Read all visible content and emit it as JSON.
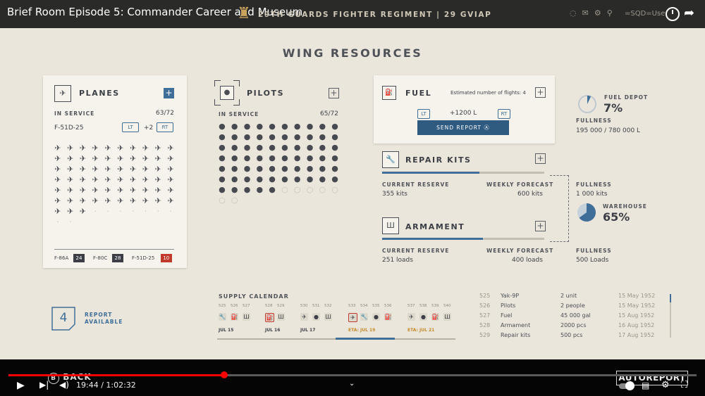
{
  "video": {
    "title": "Brief Room Episode 5: Commander Career and Museum"
  },
  "topbar": {
    "regiment": "29TH GUARDS FIGHTER REGIMENT | 29 GVIAP",
    "user_label": "=SQD=Use"
  },
  "page": {
    "heading": "WING RESOURCES"
  },
  "planes": {
    "title": "PLANES",
    "in_service_label": "IN SERVICE",
    "in_service_count": "63/72",
    "selected": "F-51D-25",
    "lt": "LT",
    "rt": "RT",
    "extra": "+2",
    "icons": [
      "✈",
      "✈",
      "✈",
      "✈",
      "✈",
      "✈",
      "✈",
      "✈",
      "✈",
      "✈",
      "✈",
      "✈",
      "✈",
      "✈",
      "✈",
      "✈",
      "✈",
      "✈",
      "✈",
      "✈",
      "✈",
      "✈",
      "✈",
      "✈",
      "✈",
      "✈",
      "✈",
      "✈",
      "✈",
      "✈",
      "✈",
      "✈",
      "✈",
      "✈",
      "✈",
      "✈",
      "✈",
      "✈",
      "✈",
      "✈",
      "✈",
      "✈",
      "✈",
      "✈",
      "✈",
      "✈",
      "✈",
      "✈",
      "✈",
      "✈",
      "✈",
      "✈",
      "✈",
      "✈",
      "✈",
      "✈",
      "✈",
      "✈",
      "✈",
      "✈",
      "✈",
      "✈",
      "✈",
      "·",
      "·",
      "·",
      "·",
      "·",
      "·",
      "·",
      "·",
      "·"
    ],
    "footer": [
      {
        "name": "F-86A",
        "count": "24"
      },
      {
        "name": "F-80C",
        "count": "28"
      },
      {
        "name": "F-51D-25",
        "count": "10"
      }
    ]
  },
  "pilots": {
    "title": "PILOTS",
    "in_service_label": "IN SERVICE",
    "in_service_count": "65/72",
    "icons": [
      "●",
      "●",
      "●",
      "●",
      "●",
      "●",
      "●",
      "●",
      "●",
      "●",
      "●",
      "●",
      "●",
      "●",
      "●",
      "●",
      "●",
      "●",
      "●",
      "●",
      "●",
      "●",
      "●",
      "●",
      "●",
      "●",
      "●",
      "●",
      "●",
      "●",
      "●",
      "●",
      "●",
      "●",
      "●",
      "●",
      "●",
      "●",
      "●",
      "●",
      "●",
      "●",
      "●",
      "●",
      "●",
      "●",
      "●",
      "●",
      "●",
      "●",
      "●",
      "●",
      "●",
      "●",
      "●",
      "●",
      "●",
      "●",
      "●",
      "●",
      "●",
      "●",
      "●",
      "●",
      "●",
      "○",
      "○",
      "○",
      "○",
      "○",
      "○",
      "○"
    ]
  },
  "fuel": {
    "title": "FUEL",
    "estimate": "Estimated number of flights: 4",
    "lt": "LT",
    "rt": "RT",
    "amount": "+1200 L",
    "send_label": "SEND REPORT",
    "depot_label": "FUEL DEPOT",
    "depot_pct": "7%",
    "depot_fraction": 0.07,
    "fullness_label": "FULLNESS",
    "fullness_value": "195 000 / 780 000 L"
  },
  "repair": {
    "title": "REPAIR KITS",
    "reserve_label": "CURRENT RESERVE",
    "reserve_value": "355 kits",
    "forecast_label": "WEEKLY FORECAST",
    "forecast_value": "600 kits",
    "fill": 0.6,
    "fullness_label": "FULLNESS",
    "fullness_value": "1 000 kits"
  },
  "warehouse": {
    "label": "WAREHOUSE",
    "pct": "65%",
    "fraction": 0.65
  },
  "armament": {
    "title": "ARMAMENT",
    "reserve_label": "CURRENT RESERVE",
    "reserve_value": "251 loads",
    "forecast_label": "WEEKLY FORECAST",
    "forecast_value": "400 loads",
    "fill": 0.62,
    "fullness_label": "FULLNESS",
    "fullness_value": "500 Loads"
  },
  "report": {
    "count": "4",
    "label1": "REPORT",
    "label2": "AVAILABLE"
  },
  "calendar": {
    "title": "SUPPLY CALENDAR",
    "groups": [
      {
        "nums": [
          "525",
          "526",
          "527"
        ],
        "icons": [
          "🔧",
          "⛽",
          "Ш"
        ],
        "date": "JUL 15"
      },
      {
        "nums": [
          "528",
          "529"
        ],
        "icons": [
          "⛽",
          "Ш"
        ],
        "date": "JUL 16"
      },
      {
        "nums": [
          "530",
          "531",
          "532"
        ],
        "icons": [
          "✈",
          "●",
          "Ш"
        ],
        "date": "JUL 17"
      },
      {
        "nums": [
          "533",
          "534",
          "535",
          "536"
        ],
        "icons": [
          "✈",
          "🔧",
          "●",
          "⛽"
        ],
        "date": "ETA: JUL 19"
      },
      {
        "nums": [
          "537",
          "538",
          "539",
          "540"
        ],
        "icons": [
          "✈",
          "●",
          "⛽",
          "Ш"
        ],
        "date": "ETA: JUL 21"
      }
    ]
  },
  "supplies": [
    {
      "id": "525",
      "item": "Yak-9P",
      "qty": "2 unit",
      "date": "15 May 1952"
    },
    {
      "id": "526",
      "item": "Pilots",
      "qty": "2 people",
      "date": "15 May 1952"
    },
    {
      "id": "527",
      "item": "Fuel",
      "qty": "45 000 gal",
      "date": "15 Aug 1952"
    },
    {
      "id": "528",
      "item": "Armament",
      "qty": "2000 pcs",
      "date": "16 Aug 1952"
    },
    {
      "id": "529",
      "item": "Repair kits",
      "qty": "500 pcs",
      "date": "17 Aug 1952"
    }
  ],
  "player": {
    "back_label": "BACK",
    "time": "19:44 / 1:02:32",
    "autoreport": "AUTOREPORT",
    "progress": 0.314
  },
  "colors": {
    "accent": "#3f6e98",
    "background": "#ebe6dc",
    "alert": "#c0392b"
  }
}
